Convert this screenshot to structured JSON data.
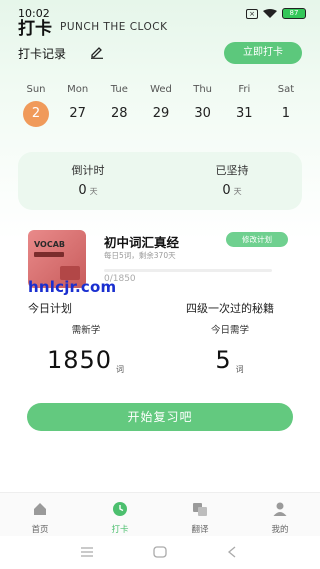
{
  "status_bar": {
    "time": "10:02",
    "battery": "87"
  },
  "header": {
    "title": "打卡",
    "subtitle": "PUNCH THE CLOCK",
    "record_label": "打卡记录",
    "checkin_button": "立即打卡"
  },
  "week": [
    {
      "name": "Sun",
      "date": "2",
      "active": true
    },
    {
      "name": "Mon",
      "date": "27"
    },
    {
      "name": "Tue",
      "date": "28"
    },
    {
      "name": "Wed",
      "date": "29"
    },
    {
      "name": "Thu",
      "date": "30"
    },
    {
      "name": "Fri",
      "date": "31"
    },
    {
      "name": "Sat",
      "date": "1"
    }
  ],
  "countdown": {
    "left_label": "倒计时",
    "left_value": "0",
    "left_unit": "天",
    "right_label": "已坚持",
    "right_value": "0",
    "right_unit": "天"
  },
  "plan": {
    "cover_text": "VOCAB",
    "book_title": "初中词汇真经",
    "book_sub": "每日5词，剩余370天",
    "modify_button": "修改计划",
    "progress_text": "0/1850",
    "progress_fraction": 0
  },
  "watermark": "hnlcjr.com",
  "today": {
    "left_heading": "今日计划",
    "right_heading": "四级一次过的秘籍",
    "left_label": "需新学",
    "left_value": "1850",
    "left_unit": "词",
    "right_label": "今日需学",
    "right_value": "5",
    "right_unit": "词"
  },
  "start_button": "开始复习吧",
  "tabs": [
    {
      "label": "首页",
      "icon": "home-icon"
    },
    {
      "label": "打卡",
      "icon": "clock-icon",
      "active": true
    },
    {
      "label": "翻译",
      "icon": "translate-icon"
    },
    {
      "label": "我的",
      "icon": "user-icon"
    }
  ],
  "colors": {
    "accent": "#5cc87c",
    "today_bg": "#f09a5a"
  }
}
